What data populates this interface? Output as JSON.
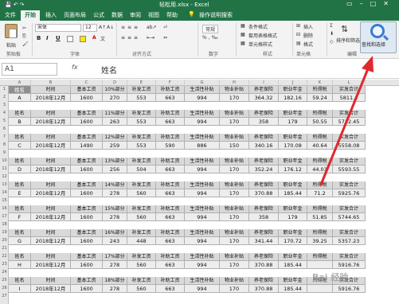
{
  "window": {
    "title": "轻松用.xlsx  -  Excel",
    "controls": [
      "restore",
      "minimize",
      "maximize",
      "close"
    ]
  },
  "ribbon_tabs": [
    "文件",
    "开始",
    "插入",
    "页面布局",
    "公式",
    "数据",
    "审阅",
    "视图",
    "帮助"
  ],
  "active_tab": "开始",
  "tell_me": "操作说明搜索",
  "ribbon": {
    "clipboard": {
      "paste": "粘贴",
      "label": "剪贴板"
    },
    "font": {
      "name": "宋体",
      "size": "12",
      "label": "字体",
      "bold": "B",
      "italic": "I",
      "underline": "U"
    },
    "align": {
      "label": "对齐方式"
    },
    "number": {
      "format": "常规",
      "label": "数字"
    },
    "styles": {
      "conditional": "条件格式",
      "table": "套用表格格式",
      "cell": "单元格样式",
      "label": "样式"
    },
    "cells": {
      "insert": "插入",
      "delete": "删除",
      "format": "格式",
      "label": "单元格"
    },
    "editing": {
      "sort": "排序和筛选",
      "find": "查找和选择",
      "label": "编辑"
    }
  },
  "formula_bar": {
    "name_box": "A1",
    "fx": "fx",
    "content": "姓名"
  },
  "columns": [
    "A",
    "B",
    "C",
    "D",
    "E",
    "F",
    "G",
    "H",
    "I",
    "J",
    "K",
    "L"
  ],
  "rows": [
    "1",
    "2",
    "3",
    "4",
    "5",
    "6",
    "7",
    "8",
    "9",
    "10",
    "11",
    "12",
    "13",
    "14",
    "15",
    "16",
    "17",
    "18",
    "19",
    "20",
    "21",
    "22",
    "23",
    "24",
    "25",
    "26",
    "27"
  ],
  "table": {
    "headers": [
      [
        "姓名",
        "时间",
        "基本工资",
        "10%部分",
        "补发工资",
        "补助工资",
        "生活性补贴",
        "物业补贴",
        "养老保险",
        "职业年金",
        "所得税",
        "实发合计"
      ],
      [
        "姓名",
        "时间",
        "基本工资",
        "11%部分",
        "补发工资",
        "补助工资",
        "生活性补贴",
        "物业补贴",
        "养老保险",
        "职业年金",
        "所得税",
        "实发合计"
      ],
      [
        "姓名",
        "时间",
        "基本工资",
        "12%部分",
        "补发工资",
        "补助工资",
        "生活性补贴",
        "物业补贴",
        "养老保险",
        "职业年金",
        "所得税",
        "实发合计"
      ],
      [
        "姓名",
        "时间",
        "基本工资",
        "13%部分",
        "补发工资",
        "补助工资",
        "生活性补贴",
        "物业补贴",
        "养老保险",
        "职业年金",
        "所得税",
        "实发合计"
      ],
      [
        "姓名",
        "时间",
        "基本工资",
        "14%部分",
        "补发工资",
        "补助工资",
        "生活性补贴",
        "物业补贴",
        "养老保险",
        "职业年金",
        "所得税",
        "实发合计"
      ],
      [
        "姓名",
        "时间",
        "基本工资",
        "15%部分",
        "补发工资",
        "补助工资",
        "生活性补贴",
        "物业补贴",
        "养老保险",
        "职业年金",
        "所得税",
        "实发合计"
      ],
      [
        "姓名",
        "时间",
        "基本工资",
        "16%部分",
        "补发工资",
        "补助工资",
        "生活性补贴",
        "物业补贴",
        "养老保险",
        "职业年金",
        "所得税",
        "实发合计"
      ],
      [
        "姓名",
        "时间",
        "基本工资",
        "17%部分",
        "补发工资",
        "补助工资",
        "生活性补贴",
        "物业补贴",
        "养老保险",
        "职业年金",
        "所得税",
        "实发合计"
      ],
      [
        "姓名",
        "时间",
        "基本工资",
        "18%部分",
        "补发工资",
        "补助工资",
        "生活性补贴",
        "物业补贴",
        "养老保险",
        "职业年金",
        "所得税",
        "实发合计"
      ]
    ],
    "records": [
      [
        "A",
        "2018年12月",
        "1600",
        "270",
        "553",
        "663",
        "994",
        "170",
        "364.32",
        "182.16",
        "59.24",
        "5811.2"
      ],
      [
        "B",
        "2018年12月",
        "1600",
        "263",
        "553",
        "663",
        "994",
        "170",
        "358",
        "179",
        "50.55",
        "5732.45"
      ],
      [
        "C",
        "2018年12月",
        "1490",
        "259",
        "553",
        "590",
        "886",
        "150",
        "340.16",
        "170.08",
        "40.64",
        "5558.08"
      ],
      [
        "D",
        "2018年12月",
        "1600",
        "256",
        "504",
        "663",
        "994",
        "170",
        "352.24",
        "176.12",
        "44.03",
        "5593.55"
      ],
      [
        "E",
        "2018年12月",
        "1600",
        "278",
        "560",
        "663",
        "994",
        "170",
        "370.88",
        "185.44",
        "71.2",
        "5925.76"
      ],
      [
        "F",
        "2018年12月",
        "1600",
        "278",
        "560",
        "663",
        "994",
        "170",
        "358",
        "179",
        "51.85",
        "5744.65"
      ],
      [
        "G",
        "2018年12月",
        "1600",
        "243",
        "448",
        "663",
        "994",
        "170",
        "341.44",
        "170.72",
        "39.25",
        "5357.23"
      ],
      [
        "H",
        "2018年12月",
        "1600",
        "278",
        "560",
        "663",
        "994",
        "170",
        "370.88",
        "185.44",
        "",
        "5916.76"
      ],
      [
        "I",
        "2018年12月",
        "1600",
        "278",
        "560",
        "663",
        "994",
        "170",
        "370.88",
        "185.44",
        "",
        "5916.76"
      ]
    ]
  },
  "watermark": "Bai 经验"
}
